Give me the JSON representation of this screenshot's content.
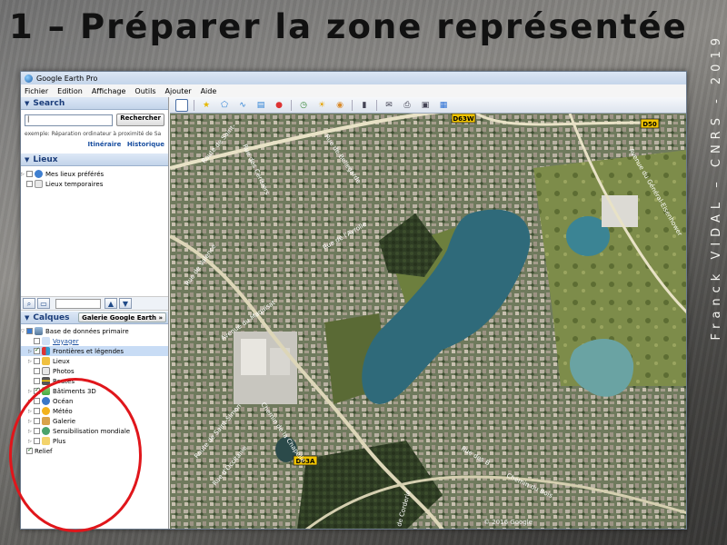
{
  "slide": {
    "title": "1 – Préparer la zone représentée",
    "side_credit": "Franck VIDAL – CNRS - 2019"
  },
  "window": {
    "title": "Google Earth Pro",
    "menu": [
      "Fichier",
      "Edition",
      "Affichage",
      "Outils",
      "Ajouter",
      "Aide"
    ]
  },
  "search": {
    "header": "Search",
    "input_value": "|",
    "button": "Rechercher",
    "hint": "exemple: Réparation ordinateur à proximité de Sa",
    "link_itinerary": "Itinéraire",
    "link_history": "Historique"
  },
  "lieux": {
    "header": "Lieux",
    "items": [
      "Mes lieux préférés",
      "Lieux temporaires"
    ]
  },
  "calques": {
    "header": "Calques",
    "gallery_button": "Galerie Google Earth",
    "gallery_arrow": "»",
    "root": "Base de données primaire",
    "layers": [
      "Voyager",
      "Frontières et légendes",
      "Lieux",
      "Photos",
      "Routes",
      "Bâtiments 3D",
      "Océan",
      "Météo",
      "Galerie",
      "Sensibilisation mondiale",
      "Plus",
      "Relief"
    ]
  },
  "map": {
    "road_labels": [
      "D63W",
      "D50",
      "D63A"
    ],
    "street_labels": [
      "Route de Saint-",
      "Rue des Cerisiers",
      "Rue de Bellegarde",
      "Rue de Valence",
      "Avenue du Maquisat",
      "Rue de l'Ayrolle",
      "Chemin de la Chapelle",
      "Rue de Corderie",
      "Rue des B",
      "Avenue du Général-Eisenhower",
      "Rue d'Occitanie",
      "Chemin du Bois",
      "Route de Saint-Simon"
    ],
    "copyright": "© 2016 Google"
  },
  "colors": {
    "title_text": "#111111",
    "credit_text": "#f4f4f0",
    "highlight_circle": "#e0161b",
    "lake": "#2f6a7a",
    "panel_header_text": "#1b3d7a"
  }
}
